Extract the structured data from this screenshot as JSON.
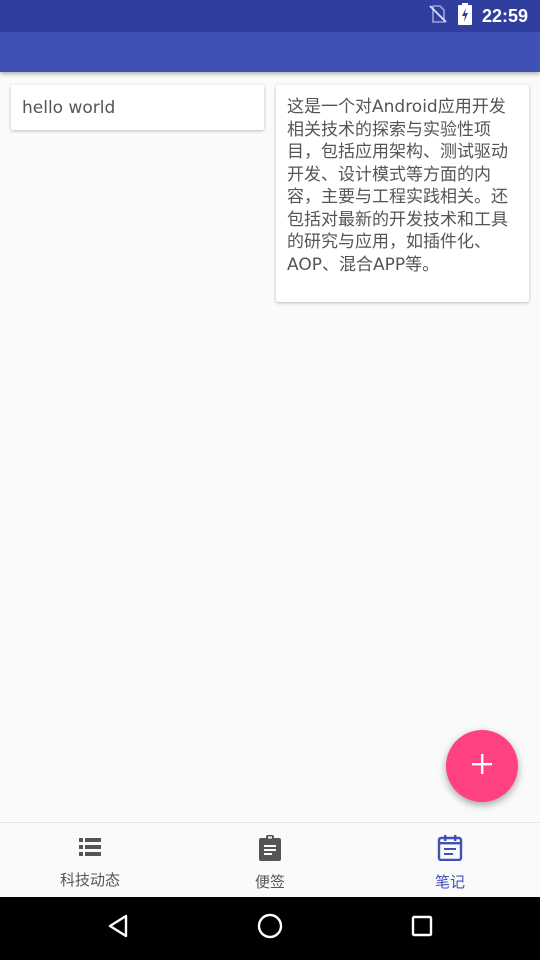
{
  "status_bar": {
    "time": "22:59",
    "icons": [
      "no-sim-icon",
      "battery-charging-icon"
    ],
    "color": "#303f9f"
  },
  "app_bar": {
    "color": "#3f51b5"
  },
  "notes": [
    {
      "text": "hello world"
    },
    {
      "text": "这是一个对Android应用开发相关技术的探索与实验性项目，包括应用架构、测试驱动开发、设计模式等方面的内容，主要与工程实践相关。还包括对最新的开发技术和工具的研究与应用，如插件化、AOP、混合APP等。"
    }
  ],
  "fab": {
    "icon": "add-icon",
    "color": "#ff4081"
  },
  "bottom_nav": {
    "items": [
      {
        "label": "科技动态",
        "icon": "list-icon",
        "active": false
      },
      {
        "label": "便签",
        "icon": "clipboard-icon",
        "active": false
      },
      {
        "label": "笔记",
        "icon": "calendar-note-icon",
        "active": true
      }
    ],
    "active_color": "#3f51b5",
    "inactive_color": "#555555"
  },
  "system_nav": {
    "buttons": [
      "back-icon",
      "home-icon",
      "recents-icon"
    ]
  }
}
